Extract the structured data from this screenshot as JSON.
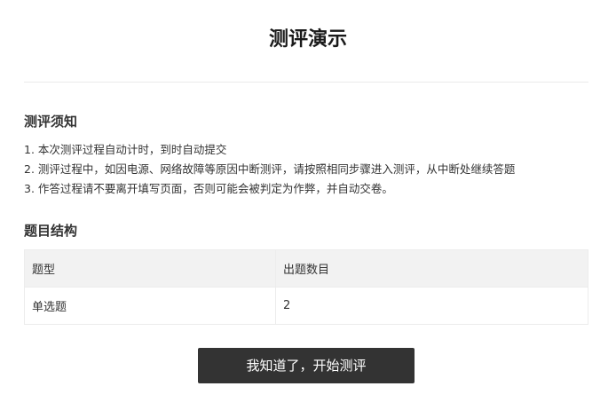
{
  "page": {
    "title": "测评演示"
  },
  "notice": {
    "heading": "测评须知",
    "items": [
      "1. 本次测评过程自动计时，到时自动提交",
      "2. 测评过程中，如因电源、网络故障等原因中断测评，请按照相同步骤进入测评，从中断处继续答题",
      "3. 作答过程请不要离开填写页面，否则可能会被判定为作弊，并自动交卷。"
    ]
  },
  "structure": {
    "heading": "题目结构",
    "columns": [
      "题型",
      "出题数目"
    ],
    "rows": [
      [
        "单选题",
        "2"
      ]
    ]
  },
  "actions": {
    "start_label": "我知道了，开始测评"
  }
}
